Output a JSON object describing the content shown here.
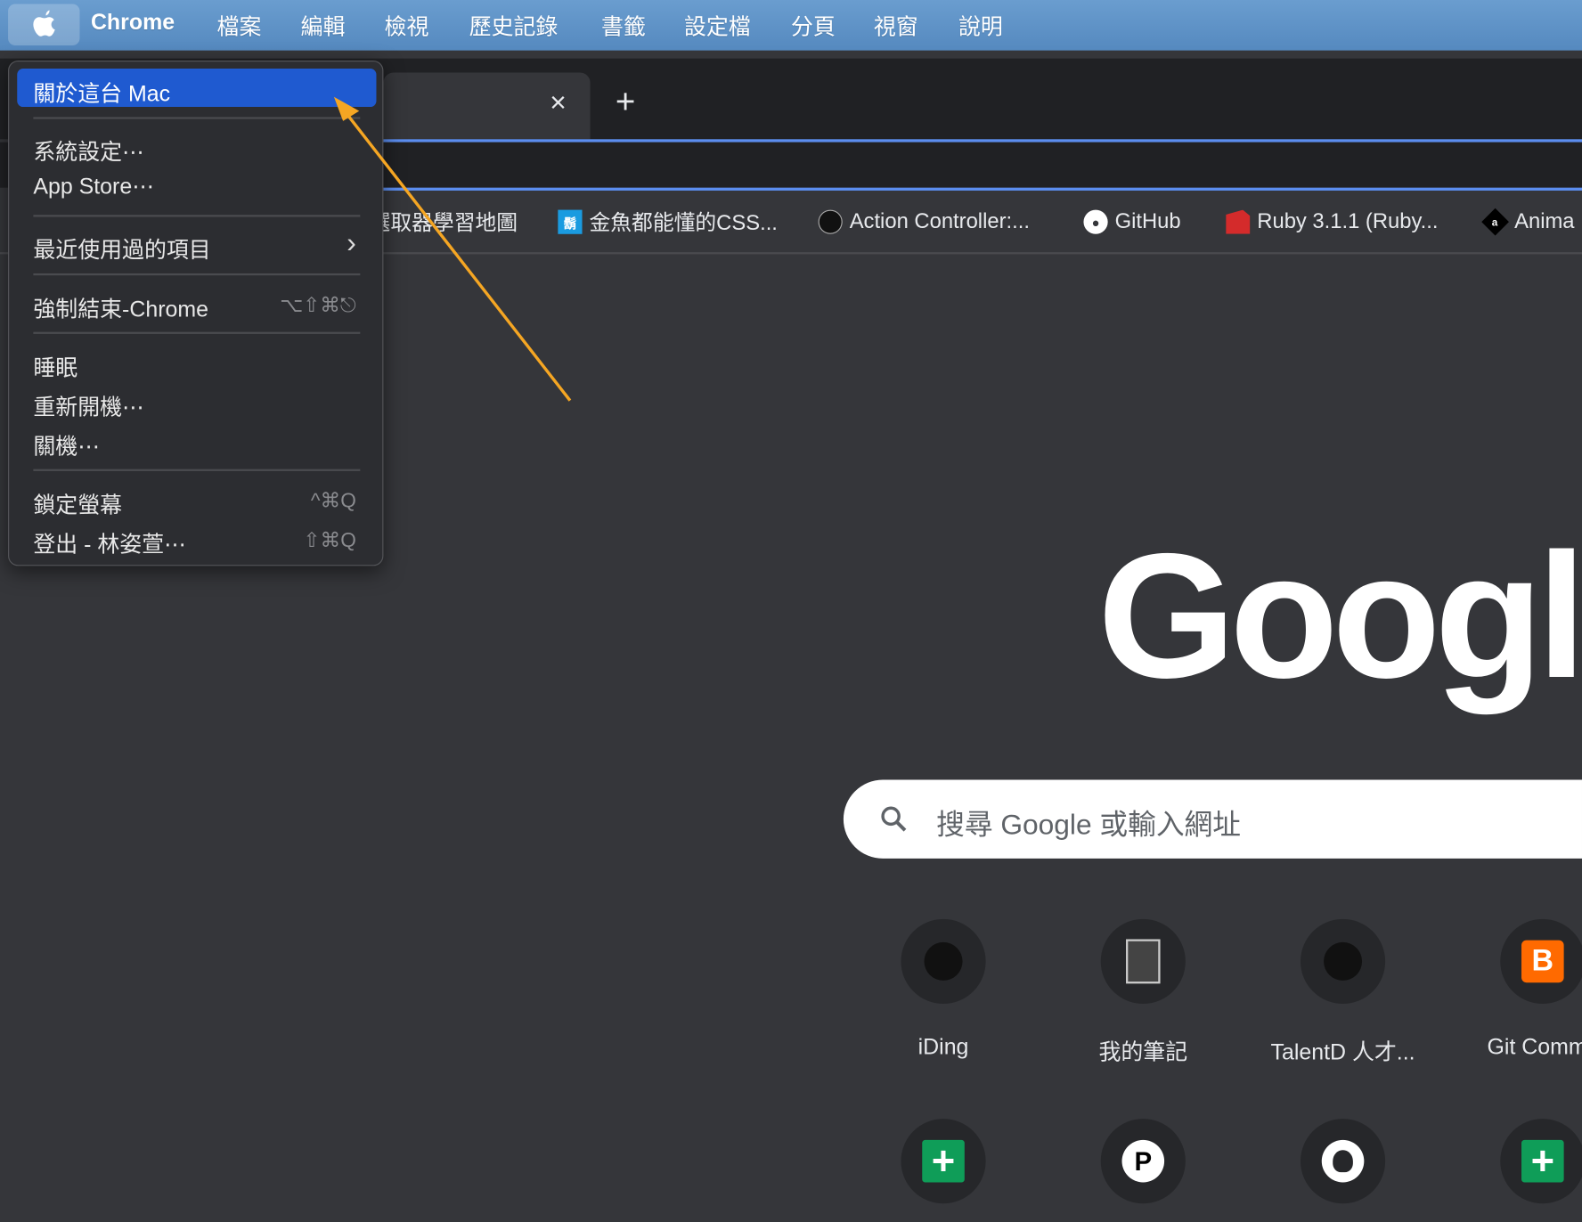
{
  "menubar": {
    "app": "Chrome",
    "items": [
      "檔案",
      "編輯",
      "檢視",
      "歷史記錄",
      "書籤",
      "設定檔",
      "分頁",
      "視窗",
      "說明"
    ]
  },
  "tabs": {
    "close": "×",
    "new_tab": "+"
  },
  "bookmarks": [
    "選取器學習地圖",
    "金魚都能懂的CSS...",
    "Action Controller:...",
    "GitHub",
    "Ruby 3.1.1 (Ruby...",
    "Anima"
  ],
  "apple_menu": {
    "items": [
      {
        "label": "關於這台 Mac",
        "shortcut": ""
      },
      {
        "label": "系統設定⋯",
        "shortcut": ""
      },
      {
        "label": "App Store⋯",
        "shortcut": ""
      },
      {
        "label": "最近使用過的項目",
        "shortcut": "›"
      },
      {
        "label": "強制結束-Chrome",
        "shortcut": "⌥⇧⌘⎋"
      },
      {
        "label": "睡眠",
        "shortcut": ""
      },
      {
        "label": "重新開機⋯",
        "shortcut": ""
      },
      {
        "label": "關機⋯",
        "shortcut": ""
      },
      {
        "label": "鎖定螢幕",
        "shortcut": "^⌘Q"
      },
      {
        "label": "登出 - 林姿萱⋯",
        "shortcut": "⇧⌘Q"
      }
    ]
  },
  "page": {
    "logo": "Google",
    "search_placeholder": "搜尋 Google 或輸入網址",
    "shortcuts": [
      "iDing",
      "我的筆記",
      "TalentD 人才...",
      "Git Commit"
    ]
  },
  "colors": {
    "highlight": "#1f5ad0",
    "arrow": "#f5a623",
    "menubar": "#5589bf"
  }
}
